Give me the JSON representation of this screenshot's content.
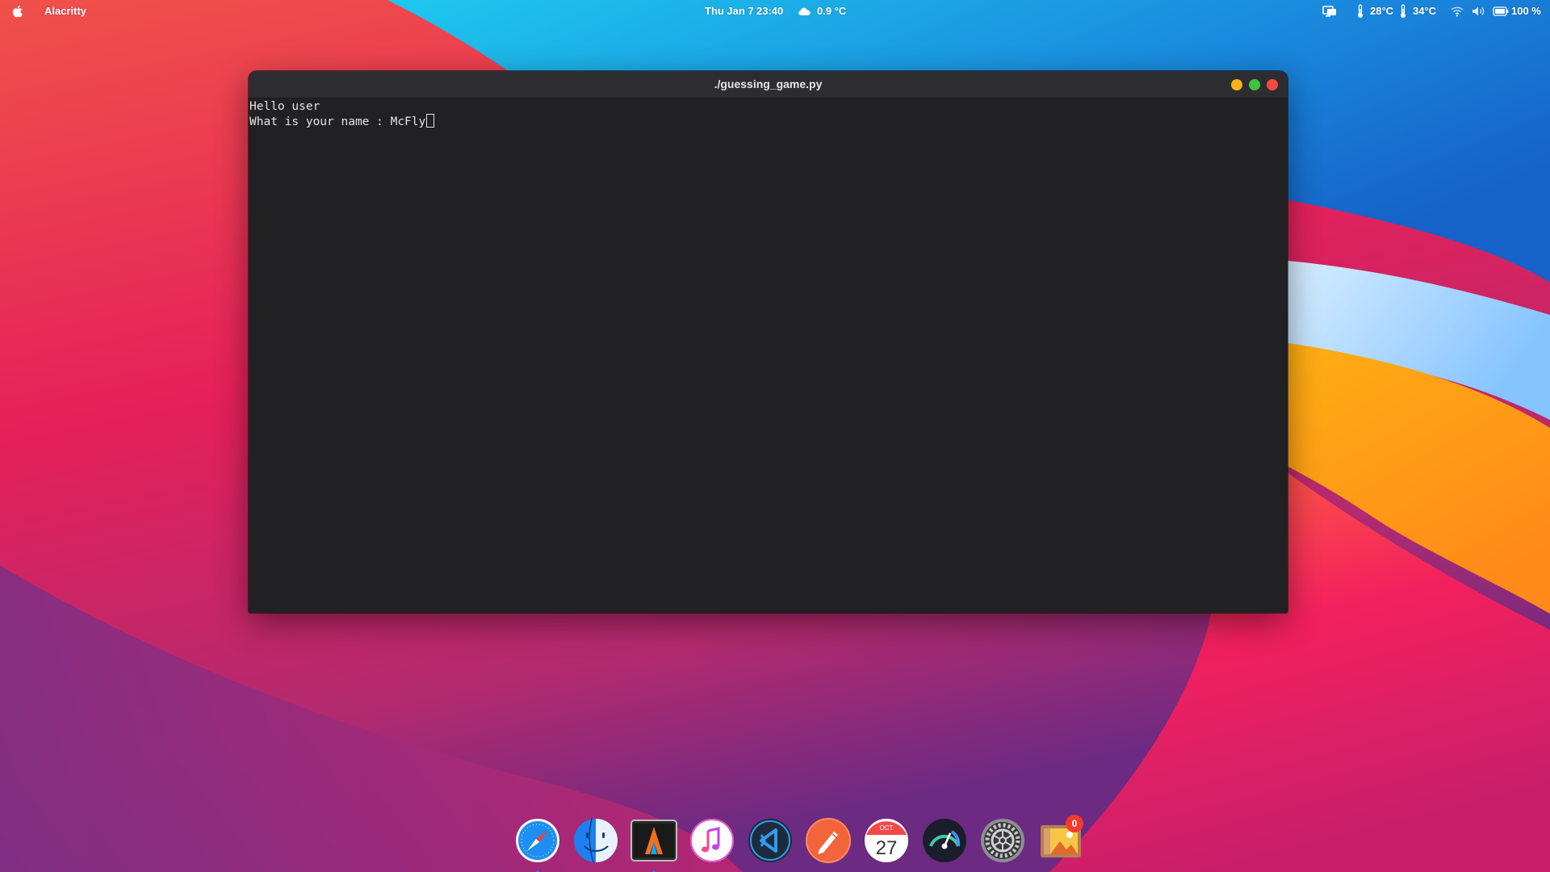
{
  "topbar": {
    "app_name": "Alacritty",
    "date": "Thu Jan 7",
    "time": "23:40",
    "weather_temp": "0.9 °C",
    "cpu_temp": "28°C",
    "gpu_temp": "34°C",
    "battery": "100 %"
  },
  "window": {
    "title": "./guessing_game.py",
    "lines": [
      "Hello user",
      "What is your name : McFly"
    ]
  },
  "dock": {
    "items": [
      "Safari",
      "Finder",
      "Alacritty",
      "Music",
      "Visual Studio Code",
      "Pencil",
      "Calendar",
      "Monitor",
      "System Preferences",
      "Image Viewer"
    ],
    "calendar_month": "OCT",
    "calendar_day": "27",
    "badge_count": "0"
  },
  "colors": {
    "terminal_bg": "#212124",
    "titlebar_bg": "#2d2d31",
    "minimize": "#f6b31e",
    "maximize": "#3fc23f",
    "close": "#f44a43"
  }
}
